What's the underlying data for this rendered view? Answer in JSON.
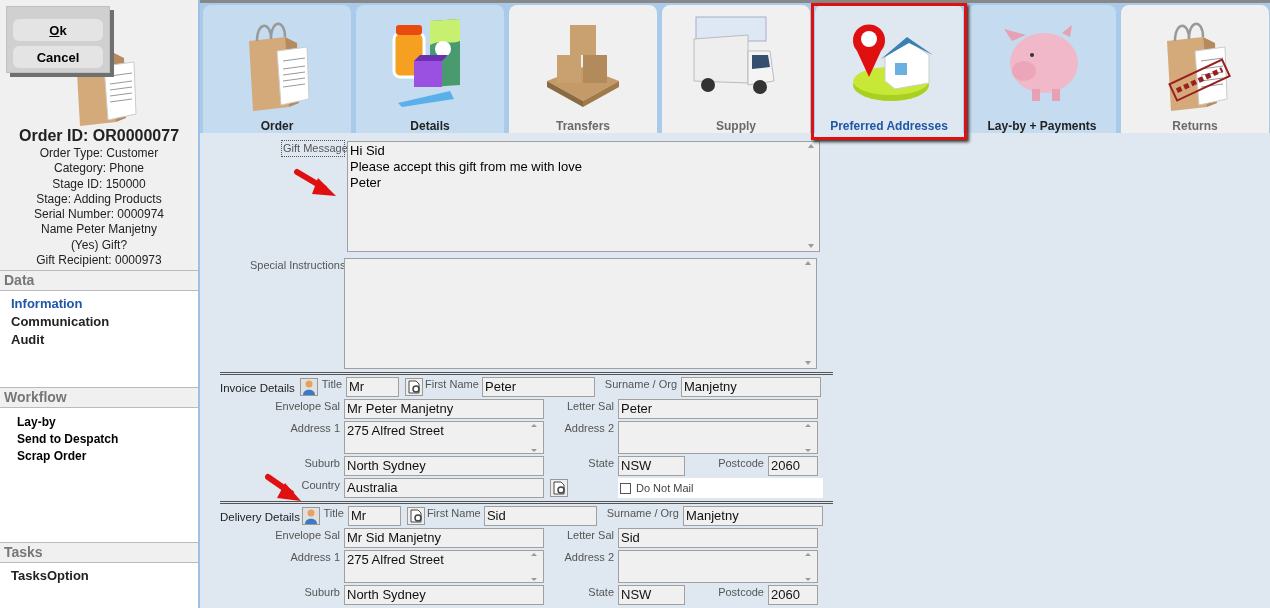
{
  "dialog": {
    "buttons": [
      {
        "label": "Ok",
        "underline_first": true
      },
      {
        "label": "Cancel",
        "underline_first": false
      }
    ]
  },
  "sidebar": {
    "order_title": "Order ID: OR0000077",
    "order_info": [
      "Order Type: Customer",
      "Category: Phone",
      "Stage ID: 150000",
      "Stage: Adding Products",
      "Serial Number: 0000974",
      "Name Peter Manjetny",
      "(Yes) Gift?",
      "Gift Recipient: 0000973"
    ],
    "sections": [
      {
        "title": "Data",
        "kind": "nav",
        "items": [
          {
            "label": "Information",
            "selected": true
          },
          {
            "label": "Communication",
            "selected": false
          },
          {
            "label": "Audit",
            "selected": false
          }
        ]
      },
      {
        "title": "Workflow",
        "kind": "action",
        "items": [
          {
            "label": "Lay-by"
          },
          {
            "label": "Send to Despatch"
          },
          {
            "label": "Scrap Order"
          }
        ]
      },
      {
        "title": "Tasks",
        "kind": "nav",
        "items": [
          {
            "label": "TasksOption",
            "selected": false
          }
        ]
      }
    ]
  },
  "tabs": [
    {
      "label": "Order",
      "kind": "bag",
      "disabled": false,
      "selected": false
    },
    {
      "label": "Details",
      "kind": "products",
      "disabled": false,
      "selected": false
    },
    {
      "label": "Transfers",
      "kind": "pallet",
      "disabled": true,
      "selected": false
    },
    {
      "label": "Supply",
      "kind": "truck",
      "disabled": true,
      "selected": false
    },
    {
      "label": "Preferred Addresses",
      "kind": "location",
      "disabled": false,
      "selected": true
    },
    {
      "label": "Lay-by + Payments",
      "kind": "piggy",
      "disabled": false,
      "selected": false
    },
    {
      "label": "Returns",
      "kind": "reject",
      "disabled": true,
      "selected": false
    }
  ],
  "form": {
    "gift_message": {
      "label": "Gift Message",
      "value": "Hi Sid\nPlease accept this gift from me with love\nPeter"
    },
    "special_instructions": {
      "label": "Special Instructions"
    },
    "sections": [
      {
        "title": "Invoice Details",
        "fields": [
          {
            "label": "Title",
            "value": "Mr"
          },
          {
            "label": "First Name",
            "value": "Peter"
          },
          {
            "label": "Surname / Org",
            "value": "Manjetny"
          },
          {
            "label": "Envelope Sal",
            "value": "Mr Peter Manjetny"
          },
          {
            "label": "Letter Sal",
            "value": "Peter"
          },
          {
            "label": "Address 1",
            "value": "275 Alfred Street"
          },
          {
            "label": "Address 2"
          },
          {
            "label": "Suburb",
            "value": "North Sydney"
          },
          {
            "label": "State",
            "value": "NSW"
          },
          {
            "label": "Postcode",
            "value": "2060"
          },
          {
            "label": "Country",
            "value": "Australia"
          }
        ],
        "do_not_mail": {
          "label": "Do Not Mail",
          "checked": false
        }
      },
      {
        "title": "Delivery Details",
        "fields": [
          {
            "label": "Title",
            "value": "Mr"
          },
          {
            "label": "First Name",
            "value": "Sid"
          },
          {
            "label": "Surname / Org",
            "value": "Manjetny"
          },
          {
            "label": "Envelope Sal",
            "value": "Mr Sid Manjetny"
          },
          {
            "label": "Letter Sal",
            "value": "Sid"
          },
          {
            "label": "Address 1",
            "value": "275 Alfred Street"
          },
          {
            "label": "Address 2"
          },
          {
            "label": "Suburb",
            "value": "North Sydney"
          },
          {
            "label": "State",
            "value": "NSW"
          },
          {
            "label": "Postcode",
            "value": "2060"
          }
        ]
      }
    ]
  }
}
